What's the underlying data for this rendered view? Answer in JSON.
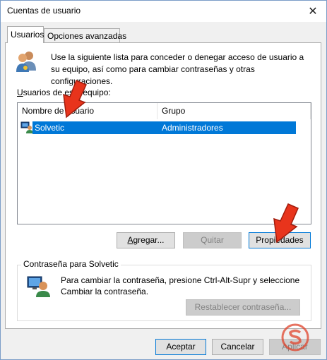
{
  "window": {
    "title": "Cuentas de usuario",
    "close_glyph": "✕"
  },
  "tabs": [
    {
      "label": "Usuarios",
      "active": true
    },
    {
      "label": "Opciones avanzadas",
      "active": false
    }
  ],
  "users_tab": {
    "description": "Use la siguiente lista para conceder o denegar acceso de usuario a su equipo, así como para cambiar contraseñas y otras configuraciones.",
    "list_label": "Usuarios de este equipo:",
    "columns": [
      "Nombre de usuario",
      "Grupo"
    ],
    "rows": [
      {
        "name": "Solvetic",
        "group": "Administradores",
        "selected": true
      }
    ],
    "buttons": {
      "add": "Agregar...",
      "remove": "Quitar",
      "properties": "Propiedades"
    }
  },
  "password_group": {
    "label": "Contraseña para Solvetic",
    "text": "Para cambiar la contraseña, presione Ctrl-Alt-Supr y seleccione Cambiar la contraseña.",
    "reset_button": "Restablecer contraseña..."
  },
  "footer": {
    "ok": "Aceptar",
    "cancel": "Cancelar",
    "apply": "Aplicar"
  },
  "colors": {
    "selection": "#0078d7",
    "annotation_arrow": "#e8341c",
    "watermark": "#e0442c"
  },
  "icons": [
    "users-icon",
    "user-monitor-icon",
    "user-icon",
    "close-icon",
    "arrow-annotation-icon",
    "watermark-logo-icon"
  ]
}
